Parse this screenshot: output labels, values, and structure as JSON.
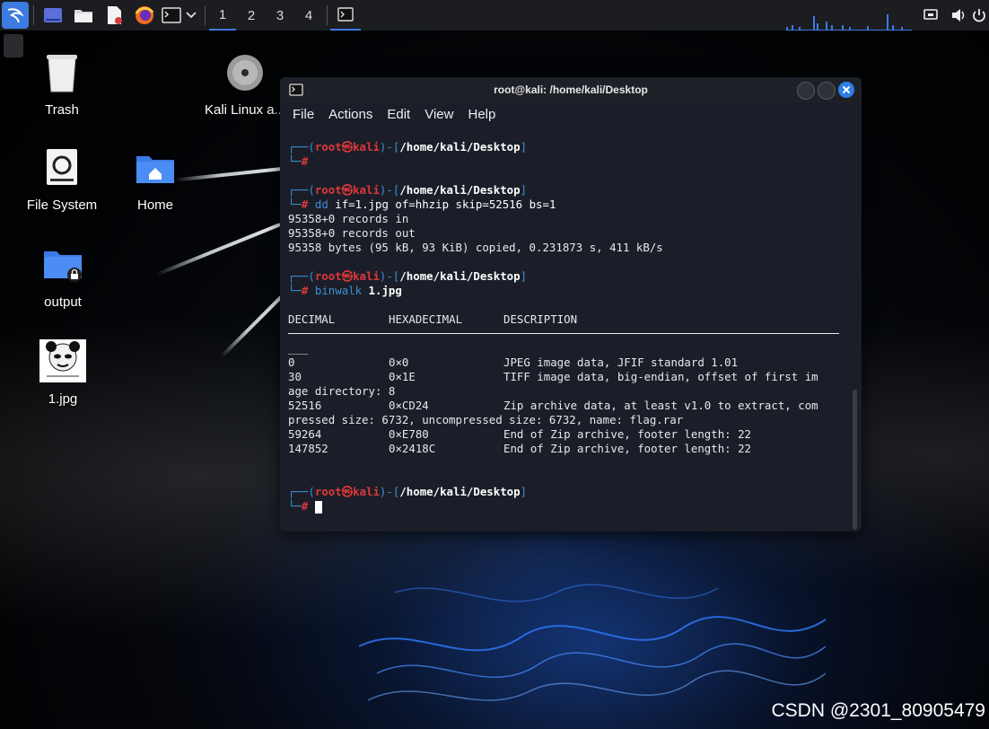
{
  "panel": {
    "workspaces": [
      "1",
      "2",
      "3",
      "4"
    ],
    "launchers": [
      "kali-menu-icon",
      "show-desktop-icon",
      "file-manager-icon",
      "text-editor-icon",
      "firefox-icon",
      "terminal-icon",
      "dropdown-chevron-icon"
    ],
    "tray": [
      "network-icon",
      "volume-icon",
      "power-icon"
    ]
  },
  "desktop": {
    "icons": [
      {
        "label": "Trash"
      },
      {
        "label": "File System"
      },
      {
        "label": "Home"
      },
      {
        "label": "output"
      },
      {
        "label": "1.jpg"
      },
      {
        "label": "Kali Linux a..."
      }
    ]
  },
  "terminal": {
    "title": "root@kali: /home/kali/Desktop",
    "menu": [
      "File",
      "Actions",
      "Edit",
      "View",
      "Help"
    ],
    "prompt": {
      "user": "root",
      "at": "㉿",
      "host": "kali",
      "path": "/home/kali/Desktop",
      "hash": "#"
    },
    "cmd2": {
      "name": "dd",
      "args": "if=1.jpg of=hhzip skip=52516 bs=1"
    },
    "dd_output": [
      "95358+0 records in",
      "95358+0 records out",
      "95358 bytes (95 kB, 93 KiB) copied, 0.231873 s, 411 kB/s"
    ],
    "cmd3": {
      "name": "binwalk",
      "args": "1.jpg"
    },
    "binwalk_header": {
      "decimal": "DECIMAL",
      "hex": "HEXADECIMAL",
      "desc": "DESCRIPTION"
    },
    "binwalk_dashes": "___",
    "binwalk_rows": [
      {
        "decimal": "0",
        "hex": "0×0",
        "desc": "JPEG image data, JFIF standard 1.01"
      },
      {
        "decimal": "30",
        "hex": "0×1E",
        "desc": "TIFF image data, big-endian, offset of first im"
      },
      {
        "decimal": "",
        "hex": "",
        "desc": "age directory: 8",
        "wrap": true
      },
      {
        "decimal": "52516",
        "hex": "0×CD24",
        "desc": "Zip archive data, at least v1.0 to extract, com"
      },
      {
        "decimal": "",
        "hex": "",
        "desc": "pressed size: 6732, uncompressed size: 6732, name: flag.rar",
        "wrap": true
      },
      {
        "decimal": "59264",
        "hex": "0×E780",
        "desc": "End of Zip archive, footer length: 22"
      },
      {
        "decimal": "147852",
        "hex": "0×2418C",
        "desc": "End of Zip archive, footer length: 22"
      }
    ]
  },
  "watermark": "CSDN @2301_80905479"
}
